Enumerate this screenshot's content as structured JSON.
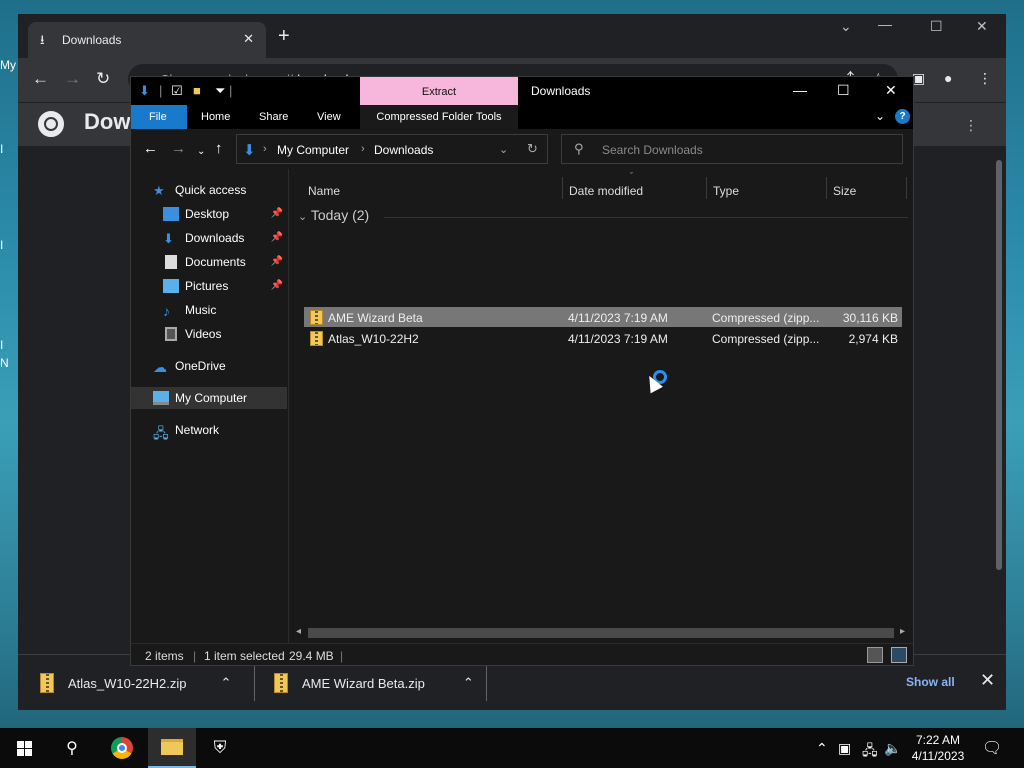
{
  "desktop": {
    "frag_top": "My",
    "frag_n1": "N",
    "frag_n2": "N"
  },
  "chrome": {
    "tab_title": "Downloads",
    "new_tab": "+",
    "url_prefix": "Chrome",
    "url_sep": "|",
    "url_scheme": "chrome://",
    "url_host": "downloads",
    "page_title": "Dow",
    "accent": "#8ab4f8"
  },
  "shelf": {
    "items": [
      {
        "name": "Atlas_W10-22H2.zip"
      },
      {
        "name": "AME Wizard Beta.zip"
      }
    ],
    "show_all": "Show all"
  },
  "explorer": {
    "title": "Downloads",
    "contextual_tab": "Extract",
    "ribbon_tabs": {
      "file": "File",
      "home": "Home",
      "share": "Share",
      "view": "View",
      "tools": "Compressed Folder Tools"
    },
    "help": "?",
    "address": {
      "crumbs": [
        "My Computer",
        "Downloads"
      ]
    },
    "search_placeholder": "Search Downloads",
    "nav": {
      "quick_access": "Quick access",
      "items": [
        "Desktop",
        "Downloads",
        "Documents",
        "Pictures",
        "Music",
        "Videos"
      ],
      "onedrive": "OneDrive",
      "my_computer": "My Computer",
      "network": "Network"
    },
    "columns": {
      "name": "Name",
      "date": "Date modified",
      "type": "Type",
      "size": "Size"
    },
    "group": "Today (2)",
    "files": [
      {
        "name": "AME Wizard Beta",
        "date": "4/11/2023 7:19 AM",
        "type": "Compressed (zipp...",
        "size": "30,116 KB"
      },
      {
        "name": "Atlas_W10-22H2",
        "date": "4/11/2023 7:19 AM",
        "type": "Compressed (zipp...",
        "size": "2,974 KB"
      }
    ],
    "status": {
      "items": "2 items",
      "selected": "1 item selected",
      "size": "29.4 MB"
    },
    "accent": "#1979ca",
    "contextual_color": "#f7b7dc"
  },
  "taskbar": {
    "time": "7:22 AM",
    "date": "4/11/2023"
  }
}
